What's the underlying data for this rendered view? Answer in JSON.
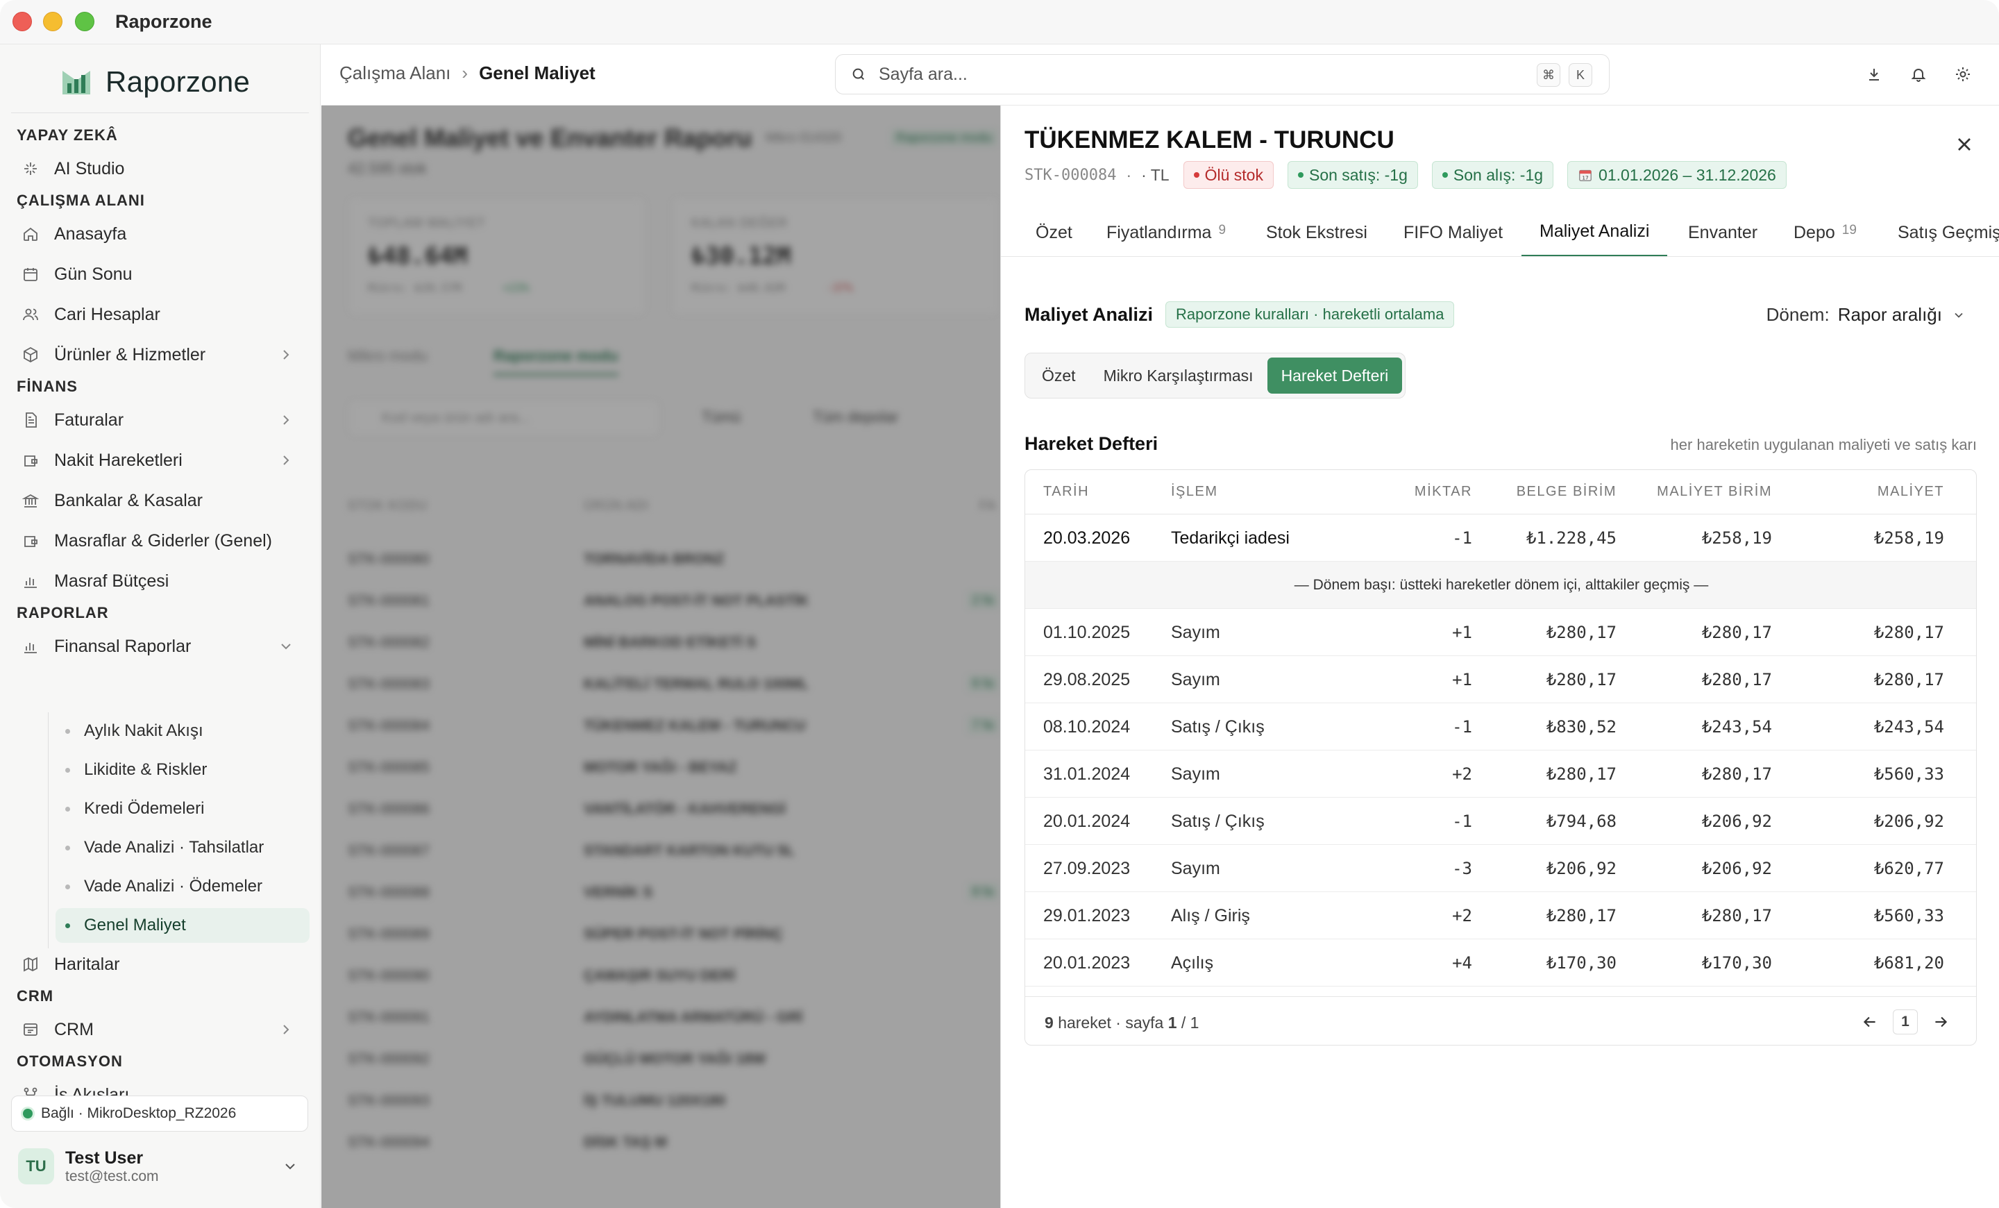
{
  "window": {
    "title": "Raporzone"
  },
  "sidebar": {
    "logo_text": "Raporzone",
    "sections": [
      {
        "label": "YAPAY ZEKÂ"
      },
      {
        "label": "ÇALIŞMA ALANI"
      },
      {
        "label": "FİNANS"
      },
      {
        "label": "RAPORLAR"
      },
      {
        "label": "CRM"
      },
      {
        "label": "OTOMASYON"
      }
    ],
    "items": [
      {
        "label": "AI Studio",
        "icon": "sparkle-icon"
      },
      {
        "label": "Anasayfa",
        "icon": "home-icon"
      },
      {
        "label": "Gün Sonu",
        "icon": "calendar-icon"
      },
      {
        "label": "Cari Hesaplar",
        "icon": "users-icon"
      },
      {
        "label": "Ürünler & Hizmetler",
        "icon": "box-icon"
      },
      {
        "label": "Faturalar",
        "icon": "document-icon"
      },
      {
        "label": "Nakit Hareketleri",
        "icon": "wallet-icon"
      },
      {
        "label": "Bankalar & Kasalar",
        "icon": "bank-icon"
      },
      {
        "label": "Masraflar & Giderler (Genel)",
        "icon": "wallet-icon"
      },
      {
        "label": "Masraf Bütçesi",
        "icon": "bar-chart-icon"
      },
      {
        "label": "Finansal Raporlar",
        "icon": "bar-chart-icon"
      },
      {
        "label": "Haritalar",
        "icon": "map-icon"
      },
      {
        "label": "CRM",
        "icon": "crm-icon"
      },
      {
        "label": "İş Akışları",
        "icon": "workflow-icon"
      }
    ],
    "sub_items": [
      {
        "label": "Aylık Nakit Akışı"
      },
      {
        "label": "Likidite & Riskler"
      },
      {
        "label": "Kredi Ödemeleri"
      },
      {
        "label": "Vade Analizi · Tahsilatlar"
      },
      {
        "label": "Vade Analizi · Ödemeler"
      },
      {
        "label": "Genel Maliyet"
      }
    ],
    "connection": "Bağlı · MikroDesktop_RZ2026",
    "user": {
      "initials": "TU",
      "name": "Test User",
      "email": "test@test.com"
    }
  },
  "topbar": {
    "breadcrumb": [
      "Çalışma Alanı",
      "Genel Maliyet"
    ],
    "search_placeholder": "Sayfa ara...",
    "shortcut": [
      "⌘",
      "K"
    ]
  },
  "background": {
    "title": "Genel Maliyet ve Envanter Raporu",
    "subtitle": "42.595 stok",
    "badge1": "Mikro 014320",
    "badge2": "Raporzone modu",
    "kpis": [
      {
        "label": "TOPLAM MALİYET",
        "value": "₺48.64M",
        "sub": "Mikro: ₺39.57M",
        "delta": "+23%",
        "delta_color": "#2f9a5d"
      },
      {
        "label": "KALAN DEĞER",
        "value": "₺30.12M",
        "sub": "Mikro: ₺48.02M",
        "delta": "-37%",
        "delta_color": "#d63b3b"
      }
    ],
    "mode_tabs": [
      "Mikro modu",
      "Raporzone modu"
    ],
    "filter_placeholder": "Kod veya ürün adı ara...",
    "filters": [
      "Tümü",
      "Tüm depolar"
    ],
    "columns": [
      "STOK KODU",
      "ÜRÜN ADI",
      "FA"
    ],
    "rows": [
      {
        "code": "STK-000080",
        "name": "TORNAVİDA BRONZ",
        "tag": ""
      },
      {
        "code": "STK-000081",
        "name": "ANALOG POST-İT NOT PLASTİK",
        "tag": "2 fa"
      },
      {
        "code": "STK-000082",
        "name": "MİNİ BARKOD ETİKETİ S",
        "tag": ""
      },
      {
        "code": "STK-000083",
        "name": "KALİTELİ TERMAL RULO 100ML",
        "tag": "6 fa"
      },
      {
        "code": "STK-000084",
        "name": "TÜKENMEZ KALEM - TURUNCU",
        "tag": "7 fa"
      },
      {
        "code": "STK-000085",
        "name": "MOTOR YAĞI - BEYAZ",
        "tag": ""
      },
      {
        "code": "STK-000086",
        "name": "VANTİLATÖR - KAHVERENGİ",
        "tag": ""
      },
      {
        "code": "STK-000087",
        "name": "STANDART KARTON KUTU 5L",
        "tag": ""
      },
      {
        "code": "STK-000088",
        "name": "VERNİK S",
        "tag": "8 fa"
      },
      {
        "code": "STK-000089",
        "name": "SÜPER POST-İT NOT PİRİNÇ",
        "tag": ""
      },
      {
        "code": "STK-000090",
        "name": "ÇAMAŞIR SUYU DERİ",
        "tag": ""
      },
      {
        "code": "STK-000091",
        "name": "AYDINLATMA ARMATÜRÜ - GRİ",
        "tag": ""
      },
      {
        "code": "STK-000092",
        "name": "GÜÇLÜ MOTOR YAĞI 18W",
        "tag": ""
      },
      {
        "code": "STK-000093",
        "name": "İŞ TULUMU 120X180",
        "tag": ""
      },
      {
        "code": "STK-000094",
        "name": "DİSK TAŞ M",
        "tag": ""
      }
    ]
  },
  "panel": {
    "title": "TÜKENMEZ KALEM - TURUNCU",
    "code": "STK-000084",
    "dot": "·",
    "currency": "· TL",
    "badges": {
      "dead_stock": "Ölü stok",
      "last_sale": "Son satış: -1g",
      "last_purchase": "Son alış: -1g",
      "date_range": "01.01.2026 – 31.12.2026"
    },
    "tabs": [
      {
        "label": "Özet",
        "count": ""
      },
      {
        "label": "Fiyatlandırma",
        "count": "9"
      },
      {
        "label": "Stok Ekstresi",
        "count": ""
      },
      {
        "label": "FIFO Maliyet",
        "count": ""
      },
      {
        "label": "Maliyet Analizi",
        "count": ""
      },
      {
        "label": "Envanter",
        "count": ""
      },
      {
        "label": "Depo",
        "count": "19"
      },
      {
        "label": "Satış Geçmişi",
        "count": ""
      }
    ],
    "analysis": {
      "heading": "Maliyet Analizi",
      "rule_tag": "Raporzone kuralları · hareketli ortalama",
      "period_label": "Dönem:",
      "period_value": "Rapor aralığı",
      "segments": [
        "Özet",
        "Mikro Karşılaştırması",
        "Hareket Defteri"
      ]
    },
    "ledger": {
      "heading": "Hareket Defteri",
      "note": "her hareketin uygulanan maliyeti ve satış karı",
      "columns": {
        "date": "TARİH",
        "op": "İŞLEM",
        "qty": "MİKTAR",
        "doc_unit": "BELGE BİRİM",
        "cost_unit": "MALİYET BİRİM",
        "cost": "MALİYET"
      },
      "first_row": {
        "date": "20.03.2026",
        "op": "Tedarikçi iadesi",
        "qty": "-1",
        "doc_unit": "₺1.228,45",
        "cost_unit": "₺258,19",
        "cost": "₺258,19"
      },
      "divider": "— Dönem başı: üstteki hareketler dönem içi, alttakiler geçmiş —",
      "rows": [
        {
          "date": "01.10.2025",
          "op": "Sayım",
          "qty": "+1",
          "doc_unit": "₺280,17",
          "cost_unit": "₺280,17",
          "cost": "₺280,17"
        },
        {
          "date": "29.08.2025",
          "op": "Sayım",
          "qty": "+1",
          "doc_unit": "₺280,17",
          "cost_unit": "₺280,17",
          "cost": "₺280,17"
        },
        {
          "date": "08.10.2024",
          "op": "Satış / Çıkış",
          "qty": "-1",
          "doc_unit": "₺830,52",
          "cost_unit": "₺243,54",
          "cost": "₺243,54"
        },
        {
          "date": "31.01.2024",
          "op": "Sayım",
          "qty": "+2",
          "doc_unit": "₺280,17",
          "cost_unit": "₺280,17",
          "cost": "₺560,33"
        },
        {
          "date": "20.01.2024",
          "op": "Satış / Çıkış",
          "qty": "-1",
          "doc_unit": "₺794,68",
          "cost_unit": "₺206,92",
          "cost": "₺206,92"
        },
        {
          "date": "27.09.2023",
          "op": "Sayım",
          "qty": "-3",
          "doc_unit": "₺206,92",
          "cost_unit": "₺206,92",
          "cost": "₺620,77"
        },
        {
          "date": "29.01.2023",
          "op": "Alış / Giriş",
          "qty": "+2",
          "doc_unit": "₺280,17",
          "cost_unit": "₺280,17",
          "cost": "₺560,33"
        },
        {
          "date": "20.01.2023",
          "op": "Açılış",
          "qty": "+4",
          "doc_unit": "₺170,30",
          "cost_unit": "₺170,30",
          "cost": "₺681,20"
        }
      ],
      "footer": {
        "count": "9",
        "count_label": "hareket · sayfa",
        "page": "1",
        "of": "/ 1",
        "current_page": "1"
      }
    }
  },
  "colors": {
    "accent": "#2f7d57",
    "accent_button": "#3f8f62",
    "danger": "#d63b3b"
  }
}
